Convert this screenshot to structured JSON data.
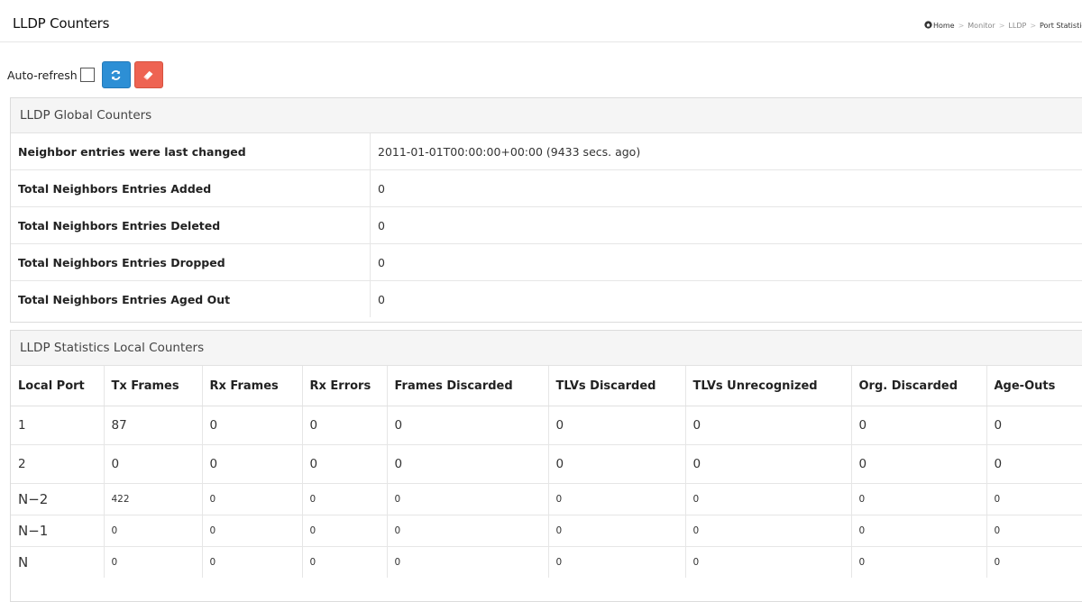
{
  "header": {
    "title": "LLDP Counters",
    "breadcrumb": {
      "home": "Home",
      "items": [
        "Monitor",
        "LLDP"
      ],
      "current": "Port Statistics"
    }
  },
  "toolbar": {
    "auto_refresh_label": "Auto-refresh",
    "auto_refresh_checked": false
  },
  "icons": {
    "home": "home-icon",
    "refresh": "refresh-icon",
    "clear": "eraser-icon"
  },
  "colors": {
    "refresh_button": "#2d8fd5",
    "clear_button": "#ee6352"
  },
  "global_counters": {
    "heading": "LLDP Global Counters",
    "rows": [
      {
        "label": "Neighbor entries were last changed",
        "value": "2011-01-01T00:00:00+00:00 (9433 secs. ago)"
      },
      {
        "label": "Total Neighbors Entries Added",
        "value": "0"
      },
      {
        "label": "Total Neighbors Entries Deleted",
        "value": "0"
      },
      {
        "label": "Total Neighbors Entries Dropped",
        "value": "0"
      },
      {
        "label": "Total Neighbors Entries Aged Out",
        "value": "0"
      }
    ]
  },
  "local_counters": {
    "heading": "LLDP Statistics Local Counters",
    "columns": [
      "Local Port",
      "Tx Frames",
      "Rx Frames",
      "Rx Errors",
      "Frames Discarded",
      "TLVs Discarded",
      "TLVs Unrecognized",
      "Org. Discarded",
      "Age-Outs"
    ],
    "rows": [
      [
        "1",
        "87",
        "0",
        "0",
        "0",
        "0",
        "0",
        "0",
        "0"
      ],
      [
        "2",
        "0",
        "0",
        "0",
        "0",
        "0",
        "0",
        "0",
        "0"
      ],
      [
        "N−2",
        "422",
        "0",
        "0",
        "0",
        "0",
        "0",
        "0",
        "0"
      ],
      [
        "N−1",
        "0",
        "0",
        "0",
        "0",
        "0",
        "0",
        "0",
        "0"
      ],
      [
        "N",
        "0",
        "0",
        "0",
        "0",
        "0",
        "0",
        "0",
        "0"
      ]
    ]
  }
}
